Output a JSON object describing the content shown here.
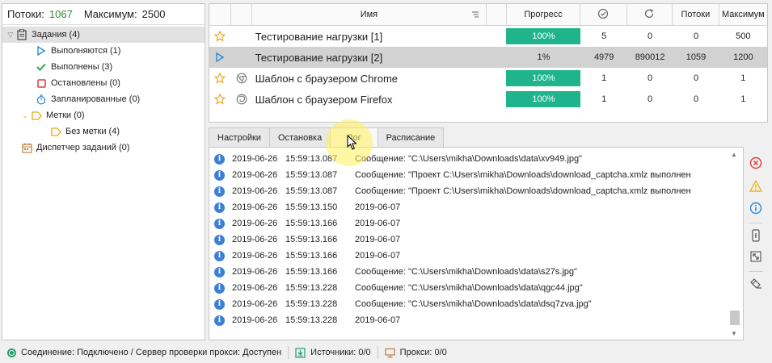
{
  "stats": {
    "threads_label": "Потоки:",
    "threads_value": "1067",
    "max_label": "Максимум:",
    "max_value": "2500"
  },
  "tree": {
    "tasks": "Задания (4)",
    "running": "Выполняются (1)",
    "completed": "Выполнены (3)",
    "stopped": "Остановлены (0)",
    "scheduled": "Запланированные (0)",
    "tags": "Метки (0)",
    "no_tag": "Без метки (4)",
    "task_manager": "Диспетчер заданий (0)"
  },
  "grid": {
    "columns": {
      "name": "Имя",
      "progress": "Прогресс",
      "threads": "Потоки",
      "max": "Максимум"
    },
    "rows": [
      {
        "name": "Тестирование нагрузки [1]",
        "progress": "100%",
        "done": "5",
        "failed": "0",
        "threads": "0",
        "max": "500"
      },
      {
        "name": "Тестирование нагрузки [2]",
        "progress": "1%",
        "done": "4979",
        "failed": "890012",
        "threads": "1059",
        "max": "1200"
      },
      {
        "name": "Шаблон с браузером Chrome",
        "progress": "100%",
        "done": "1",
        "failed": "0",
        "threads": "0",
        "max": "1"
      },
      {
        "name": "Шаблон с браузером Firefox",
        "progress": "100%",
        "done": "1",
        "failed": "0",
        "threads": "0",
        "max": "1"
      }
    ]
  },
  "tabs": {
    "settings": "Настройки",
    "stop": "Остановка",
    "log": "Лог",
    "schedule": "Расписание"
  },
  "log": [
    {
      "date": "2019-06-26",
      "time": "15:59:13.087",
      "msg": "Сообщение: \"C:\\Users\\mikha\\Downloads\\data\\xv949.jpg\""
    },
    {
      "date": "2019-06-26",
      "time": "15:59:13.087",
      "msg": "Сообщение: \"Проект C:\\Users\\mikha\\Downloads\\download_captcha.xmlz выполнен"
    },
    {
      "date": "2019-06-26",
      "time": "15:59:13.087",
      "msg": "Сообщение: \"Проект C:\\Users\\mikha\\Downloads\\download_captcha.xmlz выполнен"
    },
    {
      "date": "2019-06-26",
      "time": "15:59:13.150",
      "msg": "2019-06-07"
    },
    {
      "date": "2019-06-26",
      "time": "15:59:13.166",
      "msg": "2019-06-07"
    },
    {
      "date": "2019-06-26",
      "time": "15:59:13.166",
      "msg": "2019-06-07"
    },
    {
      "date": "2019-06-26",
      "time": "15:59:13.166",
      "msg": "2019-06-07"
    },
    {
      "date": "2019-06-26",
      "time": "15:59:13.166",
      "msg": "Сообщение: \"C:\\Users\\mikha\\Downloads\\data\\s27s.jpg\""
    },
    {
      "date": "2019-06-26",
      "time": "15:59:13.228",
      "msg": "Сообщение: \"C:\\Users\\mikha\\Downloads\\data\\qgc44.jpg\""
    },
    {
      "date": "2019-06-26",
      "time": "15:59:13.228",
      "msg": "Сообщение: \"C:\\Users\\mikha\\Downloads\\data\\dsq7zva.jpg\""
    },
    {
      "date": "2019-06-26",
      "time": "15:59:13.228",
      "msg": "2019-06-07"
    }
  ],
  "status": {
    "connection": "Соединение: Подключено / Сервер проверки прокси: Доступен",
    "sources": "Источники: 0/0",
    "proxies": "Прокси: 0/0"
  },
  "colors": {
    "progress_fill": "#20b48c",
    "threads_value": "#2e8b2e",
    "selection": "#d2d2d2",
    "info_icon": "#3e7fd6",
    "error_icon": "#e03c3c",
    "warning_icon": "#f0b429",
    "star": "#e8a317"
  }
}
